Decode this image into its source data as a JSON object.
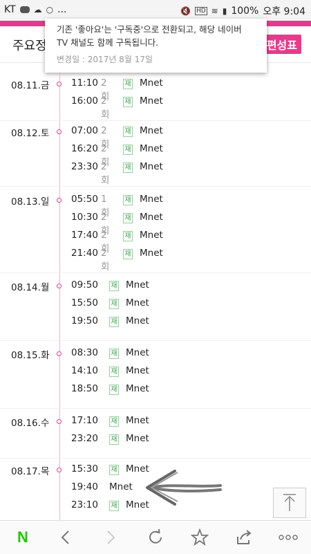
{
  "status_bar": {
    "carrier": "KT",
    "talk_label": "TALK",
    "more": "...",
    "hd_label": "HD",
    "battery": "100%",
    "time": "오후 9:04"
  },
  "header": {
    "title_visible": "주요정",
    "schedule_button": "편성표"
  },
  "tooltip": {
    "line1": "기존 '좋아요'는 '구독중'으로 전환되고, 해당 네이버",
    "line2": "TV 채널도 함께 구독됩니다.",
    "date": "변경일 : 2017년 8월 17일"
  },
  "schedule": [
    {
      "date": "08.11.금",
      "entries": [
        {
          "time": "11:10",
          "episode": "2회",
          "rerun": "재",
          "channel": "Mnet"
        },
        {
          "time": "16:00",
          "episode": "2회",
          "rerun": "재",
          "channel": "Mnet"
        }
      ]
    },
    {
      "date": "08.12.토",
      "entries": [
        {
          "time": "07:00",
          "episode": "2회",
          "rerun": "재",
          "channel": "Mnet"
        },
        {
          "time": "16:20",
          "episode": "2회",
          "rerun": "재",
          "channel": "Mnet"
        },
        {
          "time": "23:30",
          "episode": "2회",
          "rerun": "재",
          "channel": "Mnet"
        }
      ]
    },
    {
      "date": "08.13.일",
      "entries": [
        {
          "time": "05:50",
          "episode": "1회",
          "rerun": "재",
          "channel": "Mnet"
        },
        {
          "time": "10:30",
          "episode": "2회",
          "rerun": "재",
          "channel": "Mnet"
        },
        {
          "time": "17:40",
          "episode": "2회",
          "rerun": "재",
          "channel": "Mnet"
        },
        {
          "time": "21:40",
          "episode": "2회",
          "rerun": "재",
          "channel": "Mnet"
        }
      ]
    },
    {
      "date": "08.14.월",
      "entries": [
        {
          "time": "09:50",
          "episode": "",
          "rerun": "재",
          "channel": "Mnet"
        },
        {
          "time": "15:50",
          "episode": "",
          "rerun": "재",
          "channel": "Mnet"
        },
        {
          "time": "19:50",
          "episode": "",
          "rerun": "재",
          "channel": "Mnet"
        }
      ]
    },
    {
      "date": "08.15.화",
      "entries": [
        {
          "time": "08:30",
          "episode": "",
          "rerun": "재",
          "channel": "Mnet"
        },
        {
          "time": "14:10",
          "episode": "",
          "rerun": "재",
          "channel": "Mnet"
        },
        {
          "time": "18:50",
          "episode": "",
          "rerun": "재",
          "channel": "Mnet"
        }
      ]
    },
    {
      "date": "08.16.수",
      "entries": [
        {
          "time": "17:10",
          "episode": "",
          "rerun": "재",
          "channel": "Mnet"
        },
        {
          "time": "23:20",
          "episode": "",
          "rerun": "재",
          "channel": "Mnet"
        }
      ]
    },
    {
      "date": "08.17.목",
      "entries": [
        {
          "time": "15:30",
          "episode": "",
          "rerun": "재",
          "channel": "Mnet"
        },
        {
          "time": "19:40",
          "episode": "",
          "rerun": "",
          "channel": "Mnet"
        },
        {
          "time": "23:10",
          "episode": "",
          "rerun": "재",
          "channel": "Mnet"
        }
      ]
    }
  ],
  "colors": {
    "accent_pink": "#e83a8c",
    "rerun_green": "#3aa54b",
    "naver_green": "#1ec800"
  },
  "bottom_bar": {
    "logo": "N",
    "icons": [
      "naver-logo-icon",
      "back-icon",
      "forward-icon",
      "refresh-icon",
      "star-icon",
      "share-icon",
      "more-icon"
    ]
  }
}
